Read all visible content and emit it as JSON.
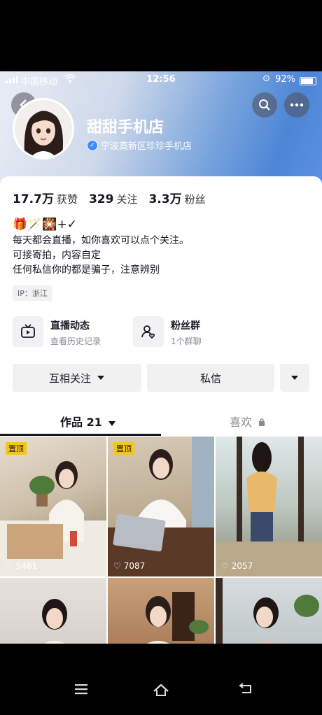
{
  "status": {
    "carrier": "中国移动",
    "time": "12:56",
    "battery": "92%"
  },
  "profile": {
    "name": "甜甜手机店",
    "verified_label": "宁波高新区珍珍手机店",
    "stats": [
      {
        "value": "17.7万",
        "label": "获赞"
      },
      {
        "value": "329",
        "label": "关注"
      },
      {
        "value": "3.3万",
        "label": "粉丝"
      }
    ],
    "emoji_line": "🎁🪄🎇+✓",
    "bio_lines": [
      "每天都会直播，如你喜欢可以点个关注。",
      "可接寄拍，内容自定",
      "任何私信你的都是骗子，注意辨别"
    ],
    "ip": "IP：浙江"
  },
  "features": [
    {
      "title": "直播动态",
      "sub": "查看历史记录",
      "icon": "tv-icon"
    },
    {
      "title": "粉丝群",
      "sub": "1个群聊",
      "icon": "group-icon"
    }
  ],
  "actions": {
    "follow": "互相关注",
    "message": "私信"
  },
  "tabs": {
    "works": "作品 21",
    "likes": "喜欢"
  },
  "videos": [
    {
      "pinned": "置顶",
      "likes": "5461"
    },
    {
      "pinned": "置顶",
      "likes": "7087"
    },
    {
      "pinned": "",
      "likes": "2057"
    },
    {
      "pinned": "",
      "likes": ""
    },
    {
      "pinned": "",
      "likes": ""
    },
    {
      "pinned": "",
      "likes": ""
    }
  ],
  "colors": {
    "accent": "#3e8ef7",
    "pin": "#f5c518"
  }
}
